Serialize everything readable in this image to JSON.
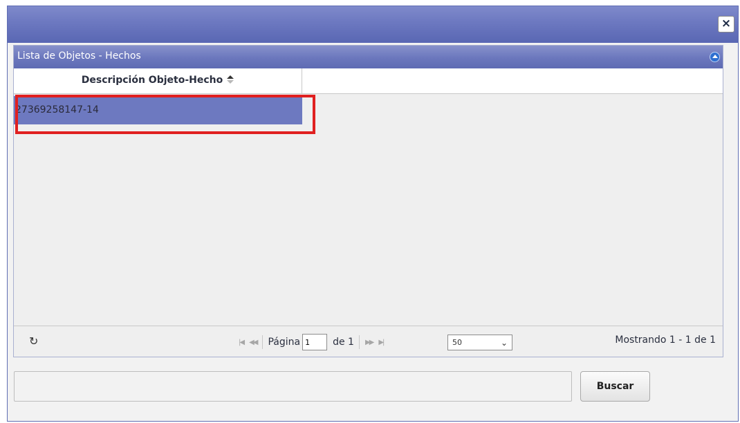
{
  "dialog": {
    "close_label": "×"
  },
  "grid": {
    "caption": "Lista de Objetos - Hechos",
    "columns": [
      "Descripción Objeto-Hecho"
    ],
    "rows": [
      {
        "descripcion": "27369258147-14",
        "selected": true
      }
    ]
  },
  "pager": {
    "refresh_icon": "↻",
    "page_label": "Página",
    "page_value": "1",
    "of_label": "de 1",
    "page_size": "50",
    "info": "Mostrando 1 - 1 de 1"
  },
  "search": {
    "value": "",
    "button_label": "Buscar"
  }
}
